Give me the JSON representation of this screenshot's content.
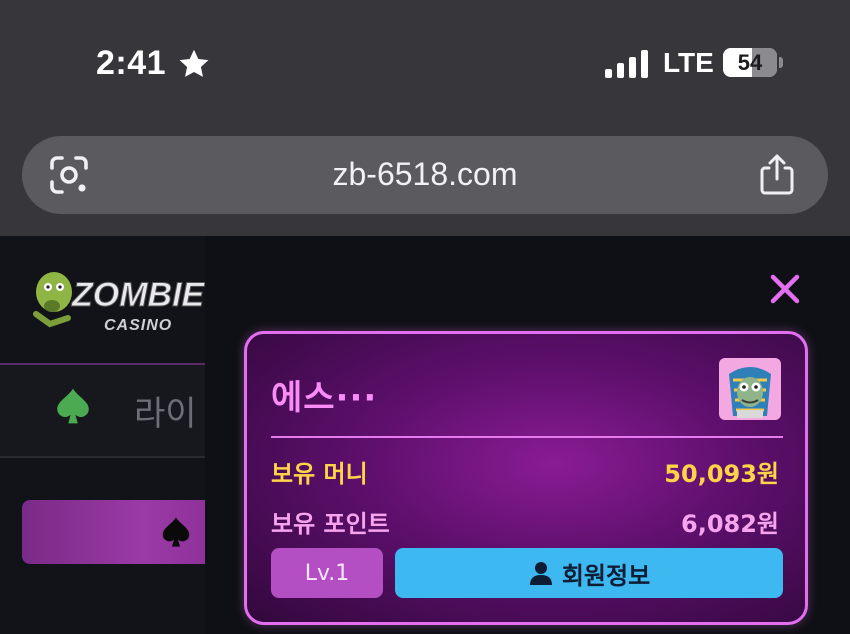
{
  "status_bar": {
    "time": "2:41",
    "time_icon": "star-icon",
    "network": "LTE",
    "battery": "54",
    "battery_level": 0.54
  },
  "url_bar": {
    "left_icon": "google-lens-icon",
    "url": "zb-6518.com",
    "right_icon": "share-icon"
  },
  "site": {
    "logo_text": "ZOMBIE CASINO",
    "nav_label": "라이",
    "nav_icon": "spade-icon",
    "tab_icon": "spade-icon"
  },
  "user_card": {
    "nickname": "에스···",
    "money_label": "보유 머니",
    "money_value": "50,093원",
    "points_label": "보유 포인트",
    "points_value": "6,082원",
    "level": "Lv.1",
    "member_info_label": "회원정보"
  },
  "colors": {
    "accent_pink": "#e36ff0",
    "money_yellow": "#ffd447",
    "button_blue": "#3db8f0",
    "level_purple": "#b34fc2",
    "spade_green": "#4caa52"
  }
}
